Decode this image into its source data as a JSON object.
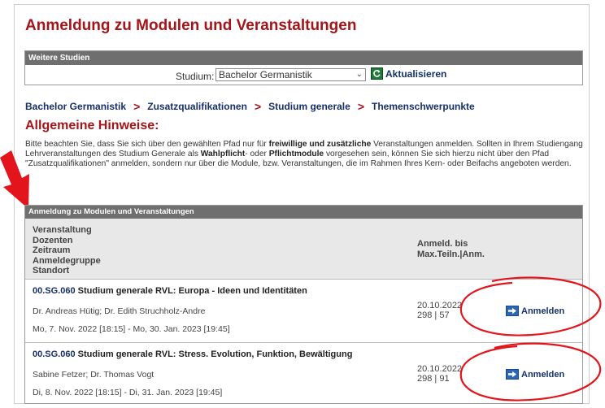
{
  "page": {
    "title": "Anmeldung zu Modulen und Veranstaltungen"
  },
  "studies_panel": {
    "header": "Weitere Studien",
    "studium_label": "Studium:",
    "studium_selected": "Bachelor Germanistik",
    "refresh_label": "Aktualisieren"
  },
  "breadcrumb": {
    "items": [
      "Bachelor Germanistik",
      "Zusatzqualifikationen",
      "Studium generale",
      "Themenschwerpunkte"
    ],
    "separator": ">"
  },
  "hints": {
    "title": "Allgemeine Hinweise:",
    "text_1": "Bitte beachten Sie, dass Sie sich über den gewählten Pfad nur für ",
    "bold_1": "freiwillige und zusätzliche",
    "text_2": " Veranstaltungen anmelden. Sollten in Ihrem Studiengang Lehrveranstaltungen des Studium Generale als ",
    "bold_2": "Wahlpflicht",
    "text_3": "- oder ",
    "bold_3": "Pflichtmodule",
    "text_4": " vorgesehen sein, können Sie sich hierzu nicht über den Pfad \"Zusatzqualifikationen\" anmelden, sondern nur über die Module, bzw. Veranstaltungen, die im Rahmen Ihres Kern- oder Beifachs angeboten werden."
  },
  "table": {
    "header": "Anmeldung zu Modulen und Veranstaltungen",
    "columns_left": [
      "Veranstaltung",
      "Dozenten",
      "Zeitraum",
      "Anmeldegruppe",
      "Standort"
    ],
    "columns_right": [
      "Anmeld. bis",
      "Max.Teiln.|Anm."
    ],
    "events": [
      {
        "code": "00.SG.060",
        "title": "Studium generale RVL: Europa - Ideen und Identitäten",
        "lecturers": "Dr. Andreas Hütig; Dr. Edith Struchholz-Andre",
        "period": "Mo, 7. Nov. 2022 [18:15] - Mo, 30. Jan. 2023 [19:45]",
        "deadline": "20.10.2022",
        "capacity": "298 | 57",
        "action": "Anmelden"
      },
      {
        "code": "00.SG.060",
        "title": "Studium generale RVL: Stress. Evolution, Funktion, Bewältigung",
        "lecturers": "Sabine Fetzer; Dr. Thomas Vogt",
        "period": "Di, 8. Nov. 2022 [18:15] - Di, 31. Jan. 2023 [19:45]",
        "deadline": "20.10.2022",
        "capacity": "298 | 91",
        "action": "Anmelden"
      }
    ]
  },
  "colors": {
    "brand_red": "#a41419",
    "link_blue": "#15306b",
    "header_gray": "#6f6f6f",
    "annotation_red": "#e3141b"
  },
  "icons": {
    "refresh": "refresh-icon",
    "register": "arrow-right-icon",
    "annotation": "red-arrow-annotation"
  }
}
